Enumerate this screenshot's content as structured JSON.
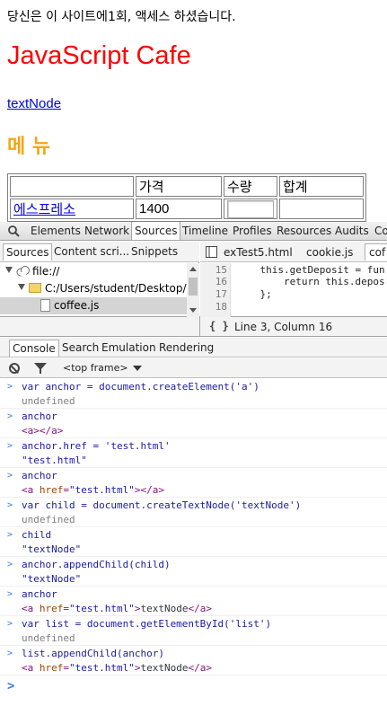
{
  "webpage": {
    "visit_text": "당신은 이 사이트에1회, 액세스 하셨습니다.",
    "title": "JavaScript Cafe",
    "link_text": "textNode",
    "menu_heading": "메 뉴",
    "table": {
      "headers": [
        "",
        "가격",
        "수량",
        "합계"
      ],
      "rows": [
        {
          "item": "에스프레소",
          "price": "1400",
          "qty": "",
          "total": ""
        }
      ]
    },
    "colors": {
      "title": "#ff0000",
      "menu_heading": "#f2a51a",
      "link": "#0000ee"
    }
  },
  "devtools": {
    "main_tabs": [
      "Elements",
      "Network",
      "Sources",
      "Timeline",
      "Profiles",
      "Resources",
      "Audits",
      "Co"
    ],
    "active_main_tab": "Sources",
    "navigator_tabs": [
      "Sources",
      "Content scri...",
      "Snippets"
    ],
    "tree": [
      {
        "label": "file://",
        "icon": "cloud-icon"
      },
      {
        "label": "C:/Users/student/Desktop/Wo",
        "icon": "folder-icon"
      },
      {
        "label": "coffee.js",
        "icon": "file-icon",
        "selected": true
      }
    ],
    "file_tabs": [
      "exTest5.html",
      "cookie.js",
      "cof"
    ],
    "code_lines": [
      {
        "num": "15",
        "text": "    this.getDeposit = fun"
      },
      {
        "num": "16",
        "text": "        return this.depos"
      },
      {
        "num": "17",
        "text": "    };"
      },
      {
        "num": "18",
        "text": ""
      }
    ],
    "status": {
      "braces": "{ }",
      "position": "Line 3, Column 16"
    },
    "drawer_tabs": [
      "Console",
      "Search",
      "Emulation",
      "Rendering"
    ],
    "active_drawer_tab": "Console",
    "frame_selector": "<top frame>",
    "console": [
      {
        "cmd": "var anchor = document.createElement('a')",
        "result": "undefined",
        "type": "undef"
      },
      {
        "cmd": "anchor",
        "result": "<a></a>",
        "type": "html"
      },
      {
        "cmd": "anchor.href = 'test.html'",
        "result": "test.html",
        "type": "str"
      },
      {
        "cmd": "anchor",
        "result": "<a href=\"test.html\"></a>",
        "type": "html"
      },
      {
        "cmd": "var child = document.createTextNode('textNode')",
        "result": "undefined",
        "type": "undef"
      },
      {
        "cmd": "child",
        "result": "textNode",
        "type": "str"
      },
      {
        "cmd": "anchor.appendChild(child)",
        "result": "textNode",
        "type": "str"
      },
      {
        "cmd": "anchor",
        "result": "<a href=\"test.html\">textNode</a>",
        "type": "html"
      },
      {
        "cmd": "var list = document.getElementById('list')",
        "result": "undefined",
        "type": "undef"
      },
      {
        "cmd": "list.appendChild(anchor)",
        "result": "<a href=\"test.html\">textNode</a>",
        "type": "html"
      }
    ],
    "prompt_symbol": ">"
  }
}
